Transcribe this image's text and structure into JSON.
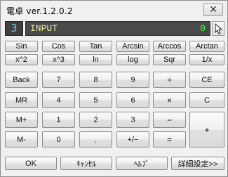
{
  "window": {
    "title": "電卓 ver.1.2.0.2",
    "close_glyph": "✕"
  },
  "display": {
    "mode": "3",
    "label": "INPUT",
    "value": "0",
    "cursor_icon": "pointer-icon"
  },
  "func_row1": [
    "Sin",
    "Cos",
    "Tan",
    "Arcsin",
    "Arccos",
    "Arctan"
  ],
  "func_row2": [
    "x^2",
    "x^3",
    "ln",
    "log",
    "Sqr",
    "1/x"
  ],
  "keys": {
    "back": "Back",
    "n7": "7",
    "n8": "8",
    "n9": "9",
    "divide": "÷",
    "ce": "CE",
    "mr": "MR",
    "n4": "4",
    "n5": "5",
    "n6": "6",
    "multiply": "×",
    "c": "C",
    "mplus": "M+",
    "n1": "1",
    "n2": "2",
    "n3": "3",
    "minus": "−",
    "plus": "+",
    "mminus": "M-",
    "n0": "0",
    "dot": ".",
    "sign": "+/−",
    "equals": "="
  },
  "footer": {
    "ok": "OK",
    "cancel": "ｷｬﾝｾﾙ",
    "help": "ﾍﾙﾌﾟ",
    "details": "詳細設定>>"
  }
}
